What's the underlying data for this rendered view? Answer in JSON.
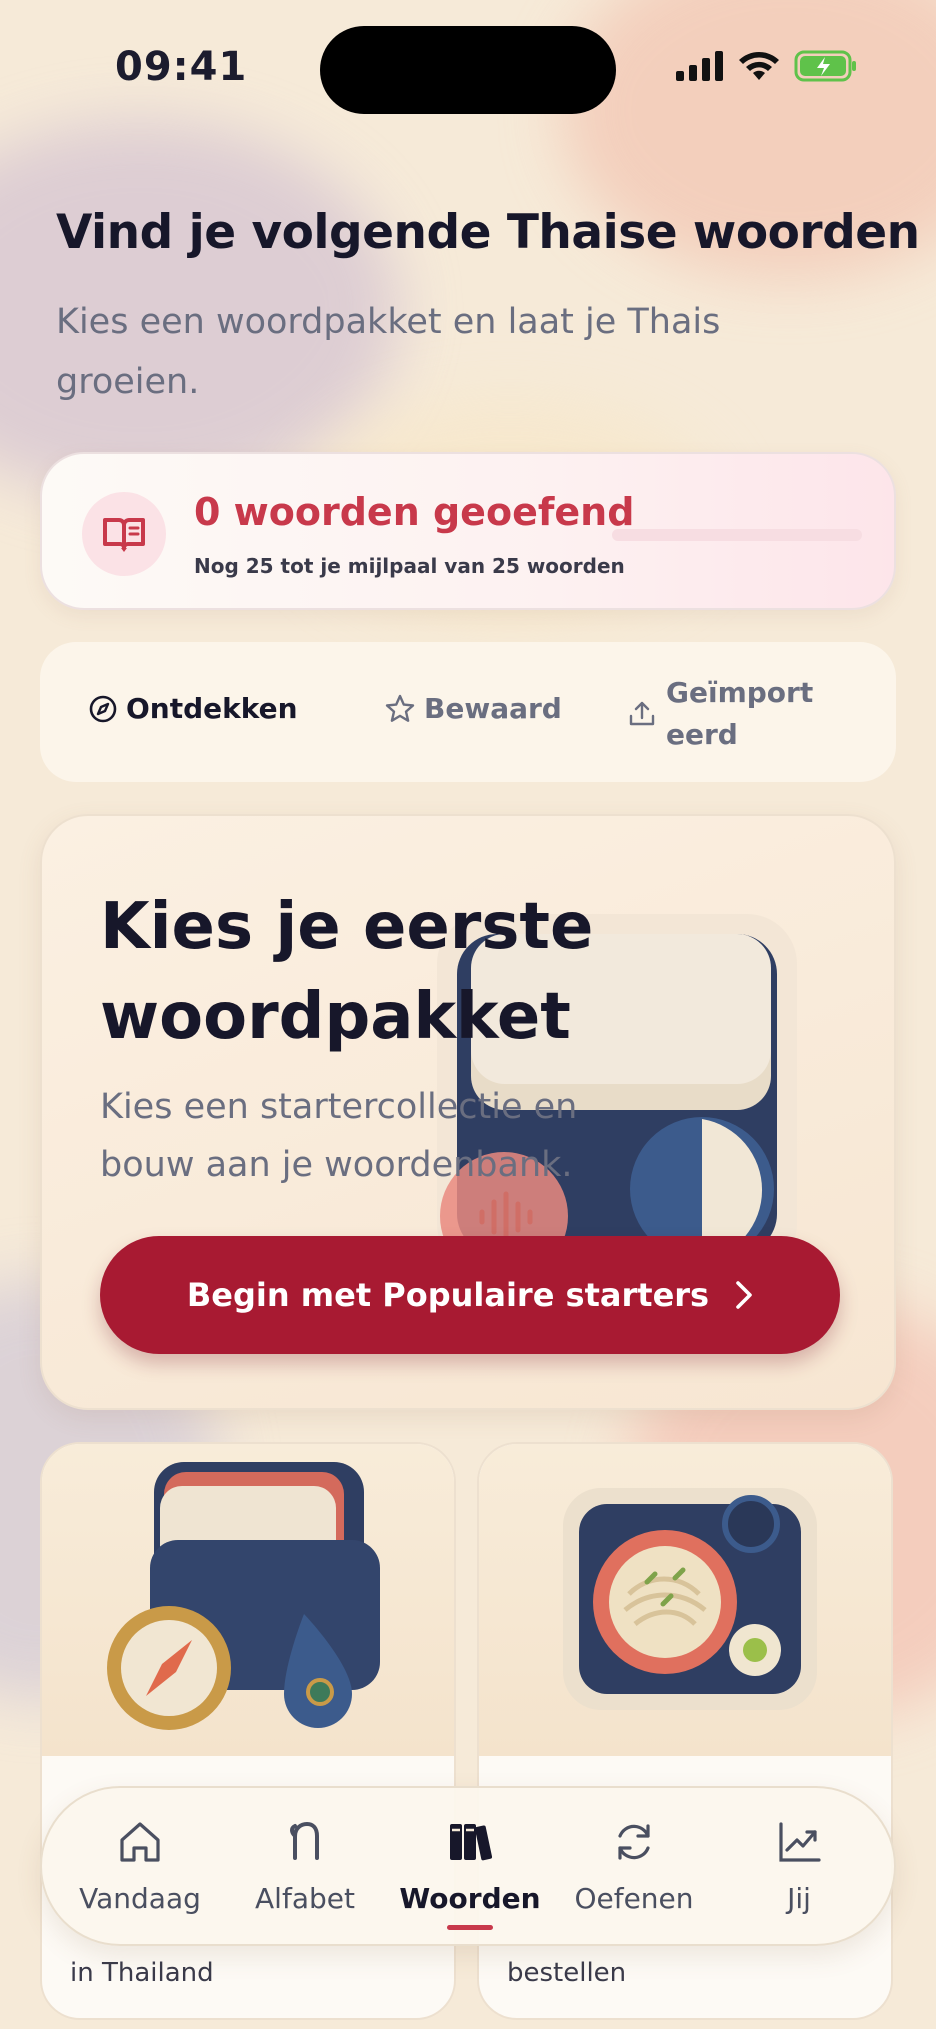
{
  "status_bar": {
    "time": "09:41"
  },
  "header": {
    "title": "Vind je volgende Thaise woorden",
    "subtitle": "Kies een woordpakket en laat je Thais groeien."
  },
  "progress": {
    "title": "0 woorden geoefend",
    "subtitle": "Nog 25 tot je mijlpaal van 25 woorden",
    "practiced": 0,
    "milestone": 25,
    "accent": "#c8394b"
  },
  "tabs": [
    {
      "label": "Ontdekken",
      "icon": "compass-icon",
      "active": true
    },
    {
      "label": "Bewaard",
      "icon": "star-icon",
      "active": false
    },
    {
      "label": "Geïmporteerd",
      "icon": "upload-icon",
      "active": false
    }
  ],
  "hero": {
    "title": "Kies je eerste woordpakket",
    "subtitle": "Kies een startercollectie en bouw aan je woordenbank.",
    "button_label": "Begin met Populaire starters",
    "button_color": "#a81a32"
  },
  "packs": [
    {
      "label": "in Thailand",
      "icon": "travel-kit-icon"
    },
    {
      "label": "bestellen",
      "icon": "noodle-bowl-icon"
    }
  ],
  "nav": [
    {
      "label": "Vandaag",
      "icon": "home-icon",
      "active": false
    },
    {
      "label": "Alfabet",
      "icon": "thai-letter-icon",
      "active": false
    },
    {
      "label": "Woorden",
      "icon": "books-icon",
      "active": true
    },
    {
      "label": "Oefenen",
      "icon": "refresh-icon",
      "active": false
    },
    {
      "label": "Jij",
      "icon": "chart-icon",
      "active": false
    }
  ]
}
